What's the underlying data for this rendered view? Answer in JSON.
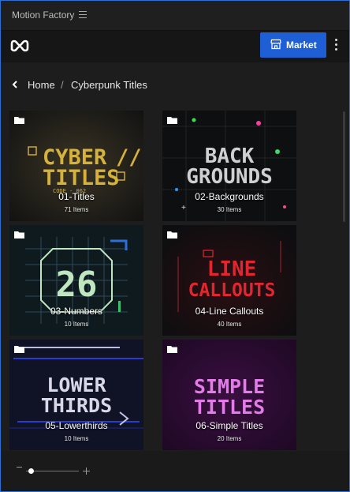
{
  "window": {
    "title": "Motion Factory"
  },
  "toolbar": {
    "market_label": "Market"
  },
  "breadcrumb": {
    "home": "Home",
    "separator": "/",
    "current": "Cyberpunk Titles"
  },
  "folders": [
    {
      "name": "01-Titles",
      "count": "71 Items",
      "art_text": [
        "CYBER",
        "TITLES"
      ],
      "art_sub": "CODE - 062",
      "accent": "#d6b23a"
    },
    {
      "name": "02-Backgrounds",
      "count": "30 Items",
      "art_text": [
        "BACK",
        "GROUNDS"
      ],
      "accent": "#d0d0d0"
    },
    {
      "name": "03-Numbers",
      "count": "10 Items",
      "art_text": [
        "26"
      ],
      "accent": "#bfe6c0"
    },
    {
      "name": "04-Line Callouts",
      "count": "40 Items",
      "art_text": [
        "LINE",
        "CALLOUTS"
      ],
      "accent": "#e2262f"
    },
    {
      "name": "05-Lowerthirds",
      "count": "10 Items",
      "art_text": [
        "LOWER",
        "THIRDS"
      ],
      "accent": "#d8d8e8"
    },
    {
      "name": "06-Simple Titles",
      "count": "20 Items",
      "art_text": [
        "SIMPLE",
        "TITLES"
      ],
      "accent": "#e37be8"
    }
  ],
  "footer": {
    "zoom": 0.05
  }
}
